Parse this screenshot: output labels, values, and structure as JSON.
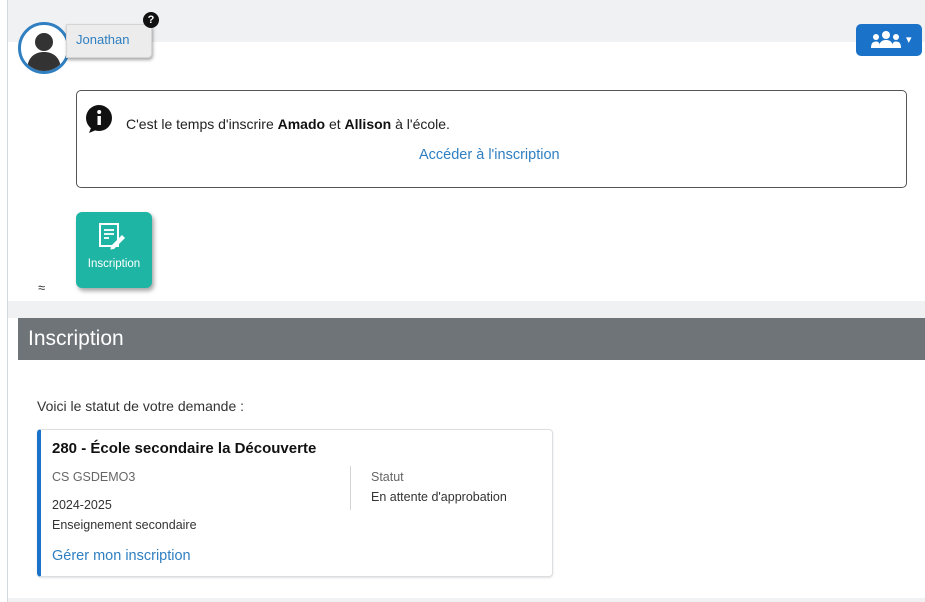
{
  "header": {
    "user_name": "Jonathan",
    "help_badge": "?",
    "avatar_icon": "user-silhouette-icon",
    "group_icon": "users-group-icon",
    "group_caret": "▾",
    "accent_color": "#1a73c8"
  },
  "notice": {
    "icon": "info-icon",
    "text_prefix": "C'est le temps d'inscrire ",
    "child_1": "Amado",
    "text_middle": " et ",
    "child_2": "Allison",
    "text_suffix": " à l'école.",
    "link_label": "Accéder à l'inscription"
  },
  "tiles": [
    {
      "label": "Inscription",
      "icon": "edit-document-icon",
      "color": "#1fb5a4"
    }
  ],
  "collapse_glyph": "≈",
  "section": {
    "title": "Inscription",
    "status_lead": "Voici le statut de votre demande :"
  },
  "request_card": {
    "school": "280 - École secondaire la Découverte",
    "service_center": "CS GSDEMO3",
    "year": "2024-2025",
    "level": "Enseignement secondaire",
    "status_label": "Statut",
    "status_value": "En attente d'approbation",
    "manage_link": "Gérer mon inscription"
  }
}
